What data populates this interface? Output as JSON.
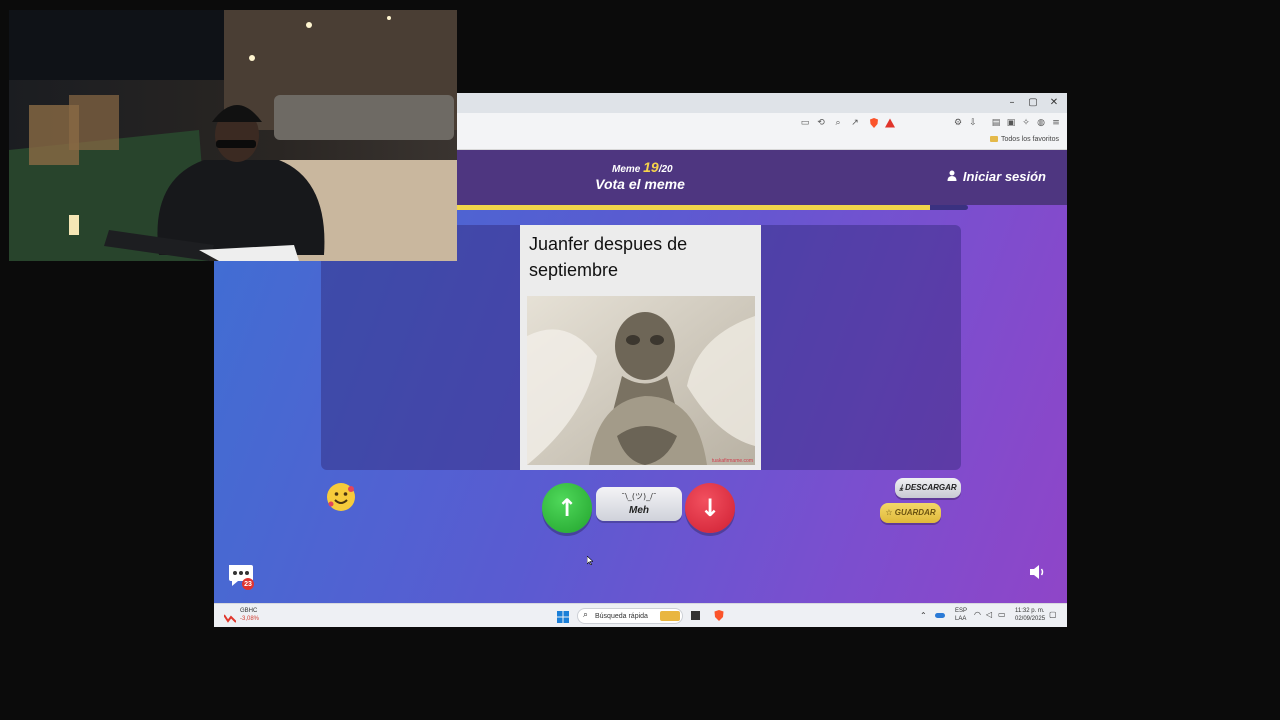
{
  "browser": {
    "bookmarks_folder_label": "Todos los favoritos",
    "window_controls": {
      "minimize": "–",
      "maximize": "▢",
      "close": "✕"
    },
    "icons": [
      "cast-icon",
      "translate-icon",
      "zoom-icon",
      "share-icon",
      "brave-shield-icon",
      "brave-rewards-icon",
      "extensions-icon",
      "sidebar-icon",
      "wallet-icon",
      "vpn-icon",
      "menu-icon"
    ]
  },
  "game": {
    "counter_prefix": "Meme",
    "counter_current": "19",
    "counter_total": "/20",
    "title": "Vota el meme",
    "login_label": "Iniciar sesión",
    "progress": 0.95,
    "meme": {
      "caption": "Juanfer despues de septiembre",
      "watermark": "tuakafirmame.com"
    },
    "meh_face": "¯\\_(ツ)_/¯",
    "meh_label": "Meh",
    "download_label": "DESCARGAR",
    "save_label": "GUARDAR",
    "chat_badge": "23",
    "colors": {
      "accent_yellow": "#f1d54a",
      "upvote": "#2bb536",
      "downvote": "#dd2a3d",
      "header": "#4e3680"
    }
  },
  "taskbar": {
    "stock_name": "GBHC",
    "stock_change": "-3,08%",
    "search_placeholder": "Búsqueda rápida",
    "language_top": "ESP",
    "language_bottom": "LAA",
    "time": "11:32 p. m.",
    "date": "02/09/2025"
  }
}
